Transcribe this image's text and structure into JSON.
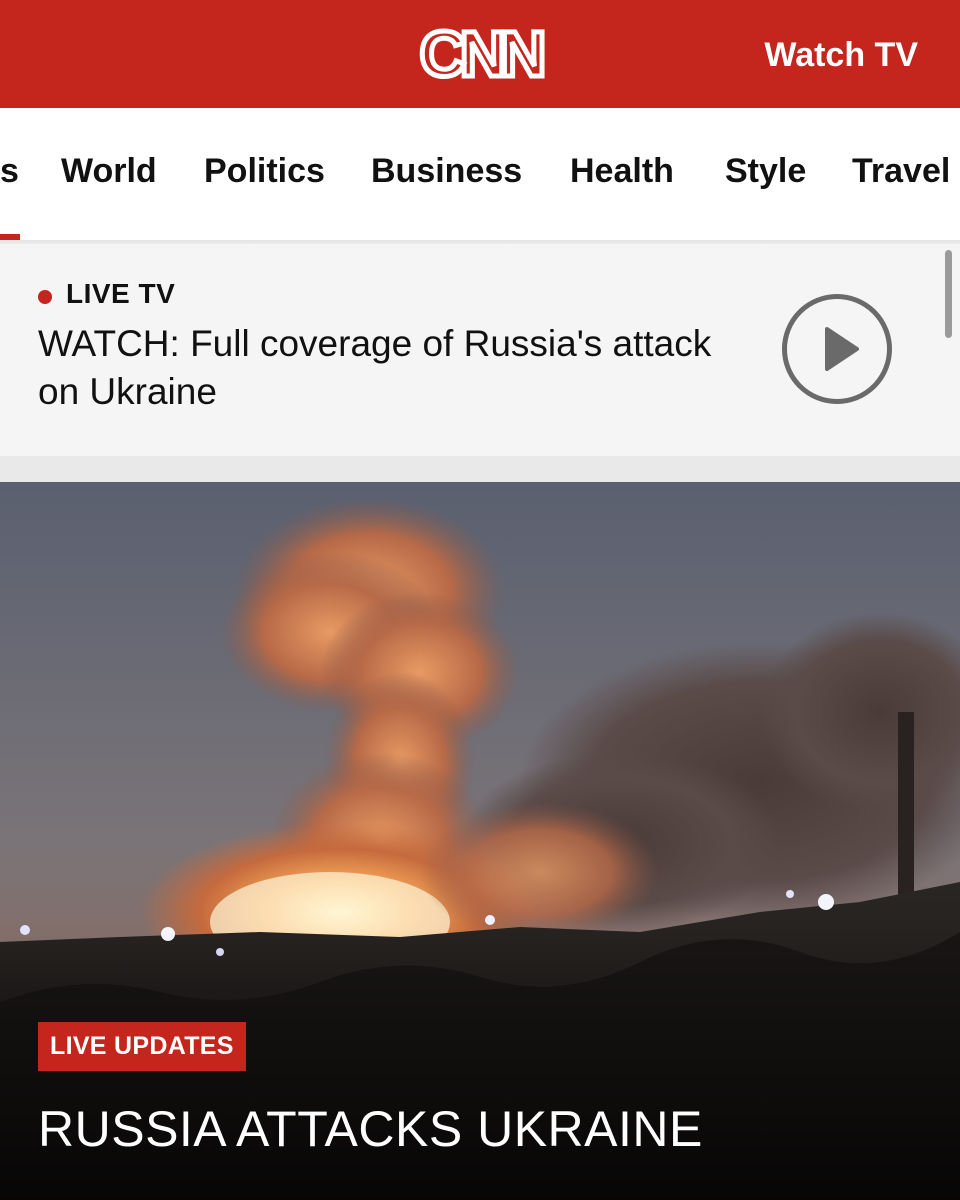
{
  "header": {
    "logo": "CNN",
    "watch_tv": "Watch TV",
    "brand_color": "#c4261d"
  },
  "nav": {
    "items": [
      "s",
      "World",
      "Politics",
      "Business",
      "Health",
      "Style",
      "Travel"
    ],
    "active_index": 0
  },
  "live_banner": {
    "label": "LIVE TV",
    "headline": "WATCH: Full coverage of Russia's attack on Ukraine",
    "play_icon": "play-icon"
  },
  "hero": {
    "badge": "LIVE UPDATES",
    "title": "RUSSIA ATTACKS UKRAINE",
    "image_icon": "explosion-photo"
  }
}
